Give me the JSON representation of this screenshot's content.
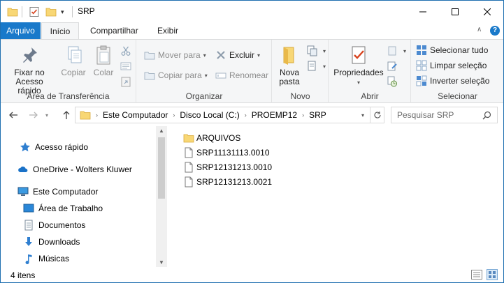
{
  "window": {
    "title": "SRP",
    "controls": {
      "minimize": "—",
      "maximize": "☐",
      "close": "✕"
    }
  },
  "quick_access_toolbar": {
    "dropdown": "▾"
  },
  "ribbon_tabs": {
    "file": "Arquivo",
    "home": "Início",
    "share": "Compartilhar",
    "view": "Exibir",
    "collapse": "∧",
    "help": "?"
  },
  "ribbon": {
    "clipboard": {
      "label": "Área de Transferência",
      "pin_quick_access_line1": "Fixar no",
      "pin_quick_access_line2": "Acesso rápido",
      "copy": "Copiar",
      "paste": "Colar"
    },
    "organize": {
      "label": "Organizar",
      "move_to": "Mover para",
      "copy_to": "Copiar para",
      "delete": "Excluir",
      "rename": "Renomear"
    },
    "new": {
      "label": "Novo",
      "new_folder_line1": "Nova",
      "new_folder_line2": "pasta"
    },
    "open": {
      "label": "Abrir",
      "properties": "Propriedades"
    },
    "select": {
      "label": "Selecionar",
      "select_all": "Selecionar tudo",
      "select_none": "Limpar seleção",
      "invert_selection": "Inverter seleção"
    }
  },
  "address_bar": {
    "breadcrumbs": [
      "Este Computador",
      "Disco Local (C:)",
      "PROEMP12",
      "SRP"
    ],
    "separator": "›"
  },
  "search": {
    "placeholder": "Pesquisar SRP"
  },
  "nav_pane": {
    "quick_access": "Acesso rápido",
    "onedrive": "OneDrive - Wolters Kluwer",
    "this_pc": "Este Computador",
    "desktop": "Área de Trabalho",
    "documents": "Documentos",
    "downloads": "Downloads",
    "music": "Músicas"
  },
  "files": [
    {
      "name": "ARQUIVOS",
      "type": "folder"
    },
    {
      "name": "SRP11131113.0010",
      "type": "file"
    },
    {
      "name": "SRP12131213.0010",
      "type": "file"
    },
    {
      "name": "SRP12131213.0021",
      "type": "file"
    }
  ],
  "status_bar": {
    "item_count": "4 itens"
  },
  "colors": {
    "accent": "#1979ca",
    "folder": "#f8d775",
    "ribbon_bg": "#f5f6f7"
  }
}
